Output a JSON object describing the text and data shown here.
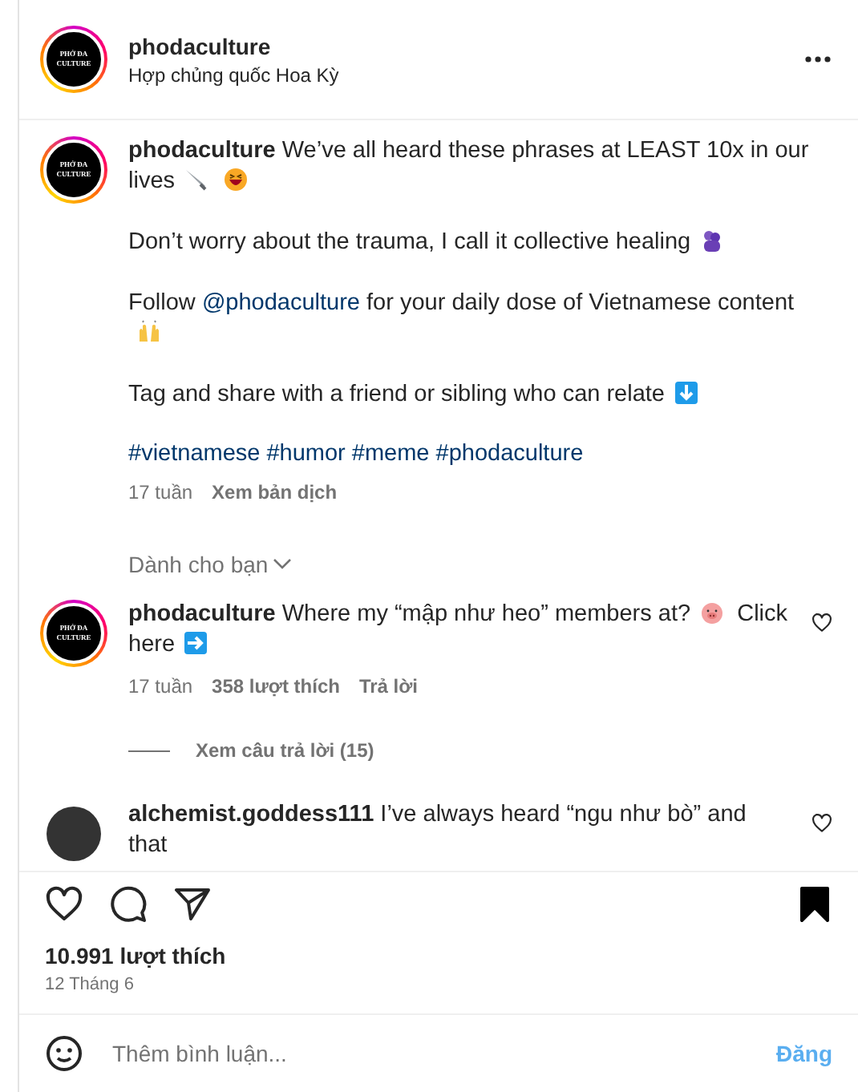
{
  "header": {
    "avatar": {
      "logo_lines": [
        "PHỞ ĐA",
        "CULTURE"
      ]
    },
    "username": "phodaculture",
    "location": "Hợp chủng quốc Hoa Kỳ"
  },
  "caption": {
    "avatar": {
      "logo_lines": [
        "PHỞ ĐA",
        "CULTURE"
      ]
    },
    "username": "phodaculture",
    "paragraphs": [
      [
        {
          "kind": "text",
          "text": "We’ve all heard these phrases at LEAST 10x in our lives"
        },
        {
          "kind": "knife"
        },
        {
          "kind": "laughing"
        }
      ],
      [
        {
          "kind": "text",
          "text": "Don’t worry about the trauma, I call it collective healing"
        },
        {
          "kind": "hug"
        }
      ],
      [
        {
          "kind": "text",
          "text": "Follow "
        },
        {
          "kind": "mention",
          "text": "@phodaculture"
        },
        {
          "kind": "text",
          "text": " for your daily dose of Vietnamese content"
        },
        {
          "kind": "hands"
        }
      ],
      [
        {
          "kind": "text",
          "text": "Tag and share with a friend or sibling who can relate"
        },
        {
          "kind": "down"
        }
      ]
    ],
    "hashtags": [
      "#vietnamese",
      "#humor",
      "#meme",
      "#phodaculture"
    ],
    "age": "17 tuần",
    "translate": "Xem bản dịch"
  },
  "for_you": "Dành cho bạn",
  "comments": [
    {
      "avatar": {
        "kind": "logo",
        "logo_lines": [
          "PHỞ ĐA",
          "CULTURE"
        ]
      },
      "username": "phodaculture",
      "segments": [
        {
          "kind": "text",
          "text": "Where my “mập như heo” members at?"
        },
        {
          "kind": "pig"
        },
        {
          "kind": "text",
          "text": " Click here"
        },
        {
          "kind": "right"
        }
      ],
      "age": "17 tuần",
      "likes": "358 lượt thích",
      "reply": "Trả lời",
      "liked": false,
      "replies": "Xem câu trả lời (15)"
    },
    {
      "avatar": {
        "kind": "photo"
      },
      "username": "alchemist.goddess111",
      "segments": [
        {
          "kind": "text",
          "text": "I’ve always heard “ngu như bò” and that"
        }
      ],
      "liked": false
    }
  ],
  "actions": {
    "liked": false,
    "saved": true
  },
  "likes": "10.991 lượt thích",
  "date": "12 Tháng 6",
  "comment_box": {
    "placeholder": "Thêm bình luận...",
    "post": "Đăng",
    "disabled": true
  }
}
